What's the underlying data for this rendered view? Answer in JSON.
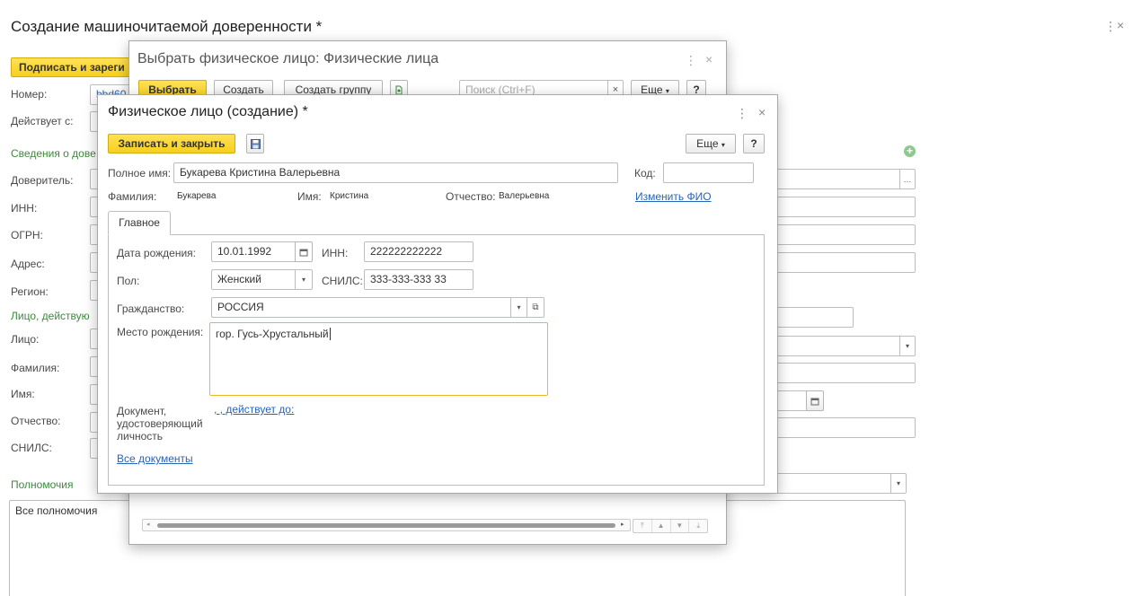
{
  "main": {
    "title": "Создание машиночитаемой доверенности *",
    "sign_button": "Подписать и зареги",
    "fields": {
      "number_label": "Номер:",
      "number_value": "bbd60",
      "valid_from_label": "Действует с:",
      "section_trust": "Сведения о дове",
      "principal_label": "Доверитель:",
      "inn_label": "ИНН:",
      "ogrn_label": "ОГРН:",
      "address_label": "Адрес:",
      "region_label": "Регион:",
      "section_person": "Лицо, действую",
      "person_label": "Лицо:",
      "surname_label": "Фамилия:",
      "name_label": "Имя:",
      "patronymic_label": "Отчество:",
      "snils_label": "СНИЛС:"
    },
    "powers_label": "Полномочия",
    "powers_value": "Все полномочия"
  },
  "picker": {
    "title": "Выбрать физическое лицо: Физические лица",
    "select_button": "Выбрать",
    "create_button": "Создать",
    "create_group_button": "Создать группу",
    "search_placeholder": "Поиск (Ctrl+F)",
    "search_clear": "×",
    "more_button": "Еще",
    "help_button": "?"
  },
  "dialog": {
    "title": "Физическое лицо (создание) *",
    "save_close_button": "Записать и закрыть",
    "more_button": "Еще",
    "help_button": "?",
    "full_name_label": "Полное имя:",
    "full_name_value": "Букарева Кристина Валерьевна",
    "code_label": "Код:",
    "code_value": "",
    "surname_label": "Фамилия:",
    "surname_value": "Букарева",
    "name_label": "Имя:",
    "name_value": "Кристина",
    "patronymic_label": "Отчество:",
    "patronymic_value": "Валерьевна",
    "change_fio_link": "Изменить ФИО",
    "tab_main": "Главное",
    "birth_date_label": "Дата рождения:",
    "birth_date_value": "10.01.1992",
    "inn_label": "ИНН:",
    "inn_value": "222222222222",
    "gender_label": "Пол:",
    "gender_value": "Женский",
    "snils_label": "СНИЛС:",
    "snils_value": "333-333-333 33",
    "citizenship_label": "Гражданство:",
    "citizenship_value": "РОССИЯ",
    "birthplace_label": "Место рождения:",
    "birthplace_value": "гор. Гусь-Хрустальный",
    "id_doc_label": "Документ, удостоверяющий личность",
    "id_doc_link": ", , действует до:",
    "all_docs_link": "Все документы"
  },
  "colors": {
    "accent_yellow": "#f6cf1e",
    "section_green": "#3c8a3c",
    "link_blue": "#2a64b5",
    "focus_border": "#e8b923"
  }
}
